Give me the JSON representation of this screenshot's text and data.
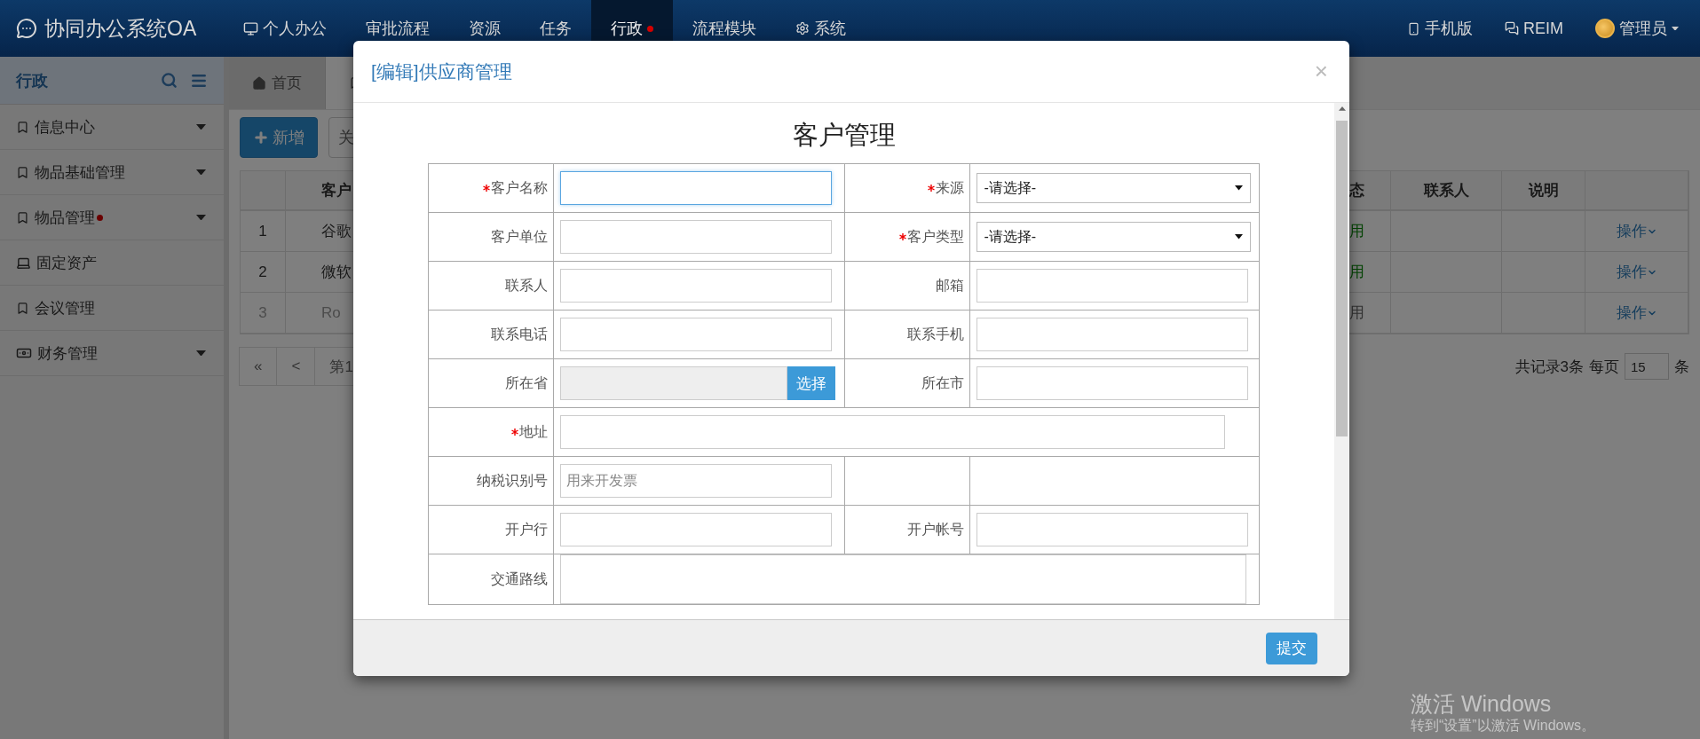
{
  "topbar": {
    "logo": "协同办公系统OA",
    "nav": [
      {
        "label": "个人办公",
        "kind": "desktop",
        "selected": false,
        "alert": false
      },
      {
        "label": "审批流程",
        "kind": "plain",
        "selected": false,
        "alert": false
      },
      {
        "label": "资源",
        "kind": "plain",
        "selected": false,
        "alert": false
      },
      {
        "label": "任务",
        "kind": "plain",
        "selected": false,
        "alert": false
      },
      {
        "label": "行政",
        "kind": "plain",
        "selected": true,
        "alert": true
      },
      {
        "label": "流程模块",
        "kind": "plain",
        "selected": false,
        "alert": false
      },
      {
        "label": "系统",
        "kind": "gear",
        "selected": false,
        "alert": false
      }
    ],
    "right": [
      {
        "label": "手机版",
        "kind": "mobile"
      },
      {
        "label": "REIM",
        "kind": "chat"
      },
      {
        "label": "管理员",
        "kind": "avatar"
      }
    ]
  },
  "sidebar": {
    "title": "行政",
    "items": [
      {
        "label": "信息中心",
        "kind": "bookmark",
        "expandable": true,
        "alert": false
      },
      {
        "label": "物品基础管理",
        "kind": "bookmark",
        "expandable": true,
        "alert": false
      },
      {
        "label": "物品管理",
        "kind": "bookmark",
        "expandable": true,
        "alert": true
      },
      {
        "label": "固定资产",
        "kind": "laptop",
        "expandable": false,
        "alert": false
      },
      {
        "label": "会议管理",
        "kind": "bookmark",
        "expandable": false,
        "alert": false
      },
      {
        "label": "财务管理",
        "kind": "money",
        "expandable": true,
        "alert": false
      }
    ]
  },
  "content": {
    "tabs": [
      {
        "label": "首页",
        "selected": false
      },
      {
        "selected": true
      }
    ],
    "toolbar": [
      {
        "label": "新增",
        "kind": "primary"
      },
      {
        "label": "关",
        "kind": "default"
      }
    ],
    "table": {
      "header_left": "客户",
      "header_right": [
        "态",
        "联系人",
        "说明"
      ],
      "rows": [
        {
          "index": "1",
          "name": "谷歌",
          "status": "用",
          "action": "操作",
          "disabled": false
        },
        {
          "index": "2",
          "name": "微软",
          "status": "用",
          "action": "操作",
          "disabled": false
        },
        {
          "index": "3",
          "name": "Ro",
          "status": "用",
          "action": "操作",
          "disabled": true
        }
      ]
    },
    "pagination": {
      "buttons": [
        "«",
        "<",
        "第1"
      ],
      "total": "共记录3条",
      "per_page_label": "每页",
      "per_page": "15",
      "unit": "条"
    }
  },
  "modal": {
    "title": "[编辑]供应商管理",
    "close": "×",
    "heading": "客户管理",
    "rows": [
      {
        "cells": [
          {
            "kind": "pair",
            "label": "客户名称",
            "required": true,
            "field": {
              "kind": "text",
              "focused": true
            }
          },
          {
            "kind": "pair",
            "label": "来源",
            "required": true,
            "field": {
              "kind": "select",
              "value": "-请选择-"
            }
          }
        ]
      },
      {
        "cells": [
          {
            "kind": "pair",
            "label": "客户单位",
            "required": false,
            "field": {
              "kind": "text",
              "focused": false
            }
          },
          {
            "kind": "pair",
            "label": "客户类型",
            "required": true,
            "field": {
              "kind": "select",
              "value": "-请选择-"
            }
          }
        ]
      },
      {
        "cells": [
          {
            "kind": "pair",
            "label": "联系人",
            "required": false,
            "field": {
              "kind": "text",
              "focused": false
            }
          },
          {
            "kind": "pair",
            "label": "邮箱",
            "required": false,
            "field": {
              "kind": "text",
              "focused": false
            }
          }
        ]
      },
      {
        "cells": [
          {
            "kind": "pair",
            "label": "联系电话",
            "required": false,
            "field": {
              "kind": "text",
              "focused": false
            }
          },
          {
            "kind": "pair",
            "label": "联系手机",
            "required": false,
            "field": {
              "kind": "text",
              "focused": false
            }
          }
        ]
      },
      {
        "cells": [
          {
            "kind": "pair",
            "label": "所在省",
            "required": false,
            "field": {
              "kind": "picker",
              "button": "选择"
            }
          },
          {
            "kind": "pair",
            "label": "所在市",
            "required": false,
            "field": {
              "kind": "text",
              "focused": false
            }
          }
        ]
      },
      {
        "cells": [
          {
            "kind": "pair",
            "label": "地址",
            "required": true,
            "field": {
              "kind": "text",
              "focused": false
            }
          }
        ]
      },
      {
        "cells": [
          {
            "kind": "pair",
            "label": "纳税识别号",
            "required": false,
            "field": {
              "kind": "text",
              "focused": false,
              "placeholder": "用来开发票"
            }
          },
          {
            "kind": "blank"
          }
        ]
      },
      {
        "cells": [
          {
            "kind": "pair",
            "label": "开户行",
            "required": false,
            "field": {
              "kind": "text",
              "focused": false
            }
          },
          {
            "kind": "pair",
            "label": "开户帐号",
            "required": false,
            "field": {
              "kind": "text",
              "focused": false
            }
          }
        ]
      },
      {
        "cells": [
          {
            "kind": "pair",
            "label": "交通路线",
            "required": false,
            "field": {
              "kind": "textarea"
            }
          }
        ]
      }
    ],
    "submit": "提交"
  },
  "watermark": {
    "title": "激活 Windows",
    "subtitle": "转到“设置”以激活 Windows。"
  }
}
